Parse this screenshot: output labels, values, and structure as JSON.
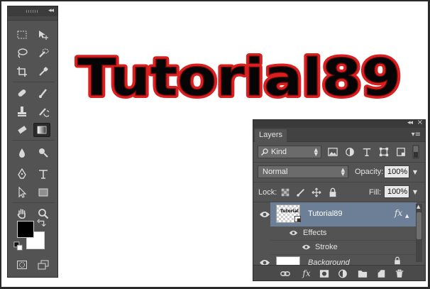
{
  "canvas": {
    "artwork_text": "Tutorial89",
    "fill_color": "#050505",
    "stroke_color": "#d91f1f"
  },
  "tools_panel": {
    "collapse_glyph": "◂◂",
    "tools": [
      {
        "name": "rectangular-marquee-icon"
      },
      {
        "name": "move-icon"
      },
      {
        "name": "lasso-icon"
      },
      {
        "name": "quick-selection-icon"
      },
      {
        "name": "crop-icon"
      },
      {
        "name": "eyedropper-icon"
      },
      {
        "name": "spot-healing-icon"
      },
      {
        "name": "brush-icon"
      },
      {
        "name": "clone-stamp-icon"
      },
      {
        "name": "history-brush-icon"
      },
      {
        "name": "eraser-icon"
      },
      {
        "name": "gradient-icon"
      },
      {
        "name": "blur-icon"
      },
      {
        "name": "dodge-icon"
      },
      {
        "name": "pen-icon"
      },
      {
        "name": "type-icon"
      },
      {
        "name": "path-selection-icon"
      },
      {
        "name": "rectangle-shape-icon"
      },
      {
        "name": "hand-icon"
      },
      {
        "name": "zoom-icon"
      }
    ],
    "foreground_color": "#000000",
    "background_color": "#ffffff"
  },
  "layers_panel": {
    "collapse_glyph": "◂◂",
    "close_glyph": "×",
    "tab_label": "Layers",
    "menu_glyph": "▾≡",
    "filter_label": "Kind",
    "blend_mode": "Normal",
    "opacity_label": "Opacity:",
    "opacity_value": "100%",
    "lock_label": "Lock:",
    "fill_label": "Fill:",
    "fill_value": "100%",
    "thumb_text": "Tutorial",
    "layers": [
      {
        "name": "Tutorial89",
        "fx": "fx",
        "selected": true
      },
      {
        "name": "Background",
        "locked": true
      }
    ],
    "effects_label": "Effects",
    "stroke_label": "Stroke",
    "fx_bottom": "fx"
  }
}
